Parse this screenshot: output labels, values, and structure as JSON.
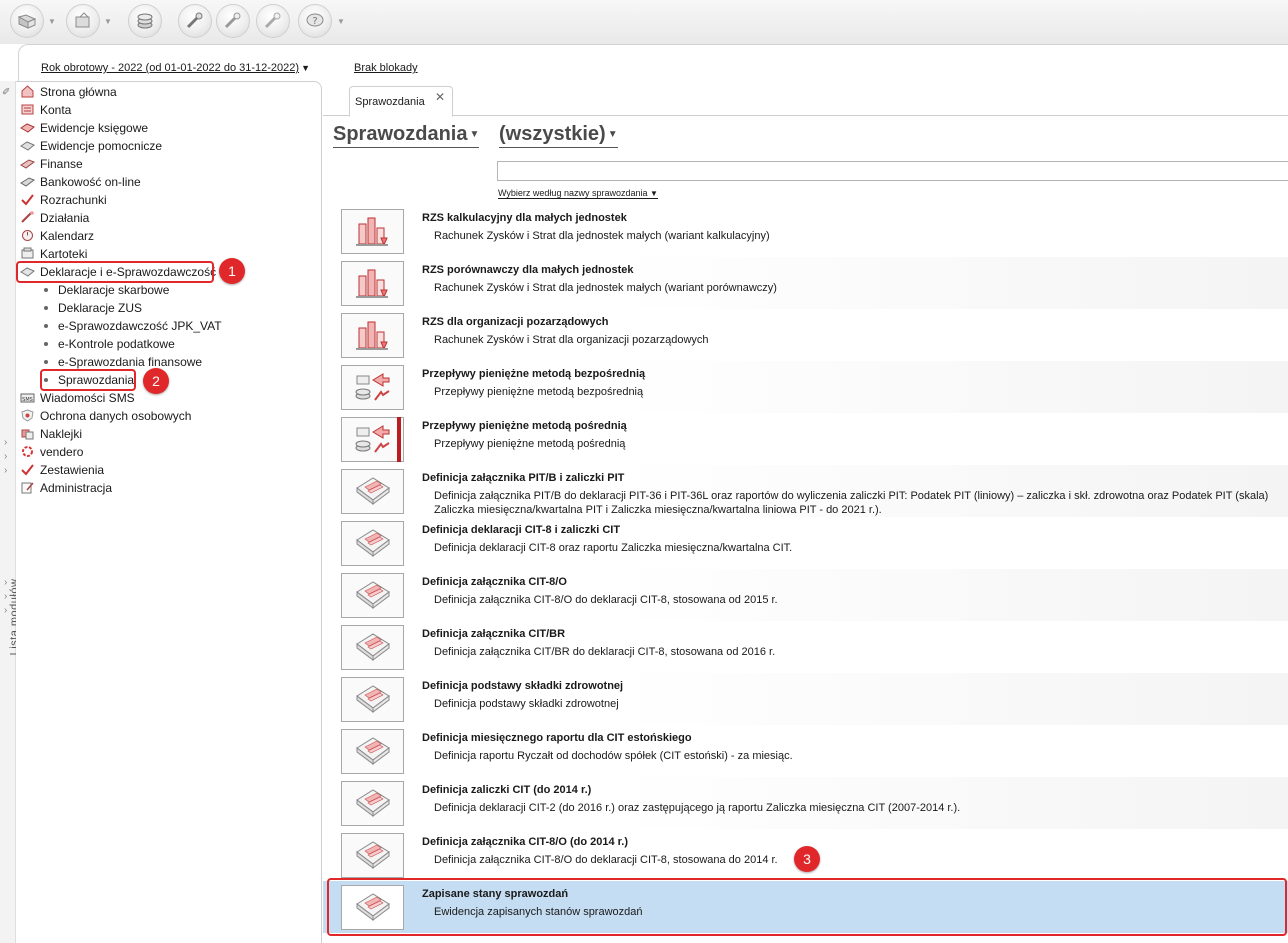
{
  "toolbar": {
    "buttons": [
      {
        "name": "open-icon"
      },
      {
        "name": "export-icon"
      },
      {
        "name": "coins-icon"
      },
      {
        "name": "tools-icon"
      },
      {
        "name": "tools-alt-icon"
      },
      {
        "name": "tools-gray-icon"
      },
      {
        "name": "help-icon"
      }
    ]
  },
  "header": {
    "fiscal_year": "Rok obrotowy - 2022  (od 01-01-2022 do 31-12-2022)",
    "lock_status": "Brak blokady"
  },
  "left_strip": {
    "label": "Lista modułów"
  },
  "sidebar": {
    "items": [
      {
        "label": "Strona główna",
        "icon": "home-icon"
      },
      {
        "label": "Konta",
        "icon": "accounts-icon"
      },
      {
        "label": "Ewidencje księgowe",
        "icon": "ledger-icon"
      },
      {
        "label": "Ewidencje pomocnicze",
        "icon": "aux-ledger-icon"
      },
      {
        "label": "Finanse",
        "icon": "finance-icon"
      },
      {
        "label": "Bankowość on-line",
        "icon": "bank-icon"
      },
      {
        "label": "Rozrachunki",
        "icon": "settlements-icon"
      },
      {
        "label": "Działania",
        "icon": "actions-icon"
      },
      {
        "label": "Kalendarz",
        "icon": "calendar-icon"
      },
      {
        "label": "Kartoteki",
        "icon": "card-index-icon"
      },
      {
        "label": "Deklaracje i e-Sprawozdawczość",
        "icon": "declarations-icon"
      }
    ],
    "sub_items": [
      {
        "label": "Deklaracje skarbowe"
      },
      {
        "label": "Deklaracje ZUS"
      },
      {
        "label": "e-Sprawozdawczość JPK_VAT"
      },
      {
        "label": "e-Kontrole podatkowe"
      },
      {
        "label": "e-Sprawozdania finansowe"
      },
      {
        "label": "Sprawozdania"
      }
    ],
    "items_after": [
      {
        "label": "Wiadomości SMS",
        "icon": "sms-icon"
      },
      {
        "label": "Ochrona danych osobowych",
        "icon": "shield-icon"
      },
      {
        "label": "Naklejki",
        "icon": "stickers-icon"
      },
      {
        "label": "vendero",
        "icon": "vendero-icon"
      },
      {
        "label": "Zestawienia",
        "icon": "summaries-icon"
      },
      {
        "label": "Administracja",
        "icon": "admin-icon"
      }
    ]
  },
  "annotations": {
    "badge_1": "1",
    "badge_2": "2",
    "badge_3": "3",
    "accent_color": "#e0282a"
  },
  "main": {
    "tab_label": "Sprawozdania",
    "tab_close": "✕",
    "view_title": "Sprawozdania",
    "filter_title": "(wszystkie)",
    "search_value": "",
    "search_hint": "Wybierz według nazwy sprawozdania",
    "selected_color": "#c4ddf2",
    "reports": [
      {
        "title": "RZS kalkulacyjny dla małych jednostek",
        "desc": "Rachunek Zysków i Strat dla jednostek małych (wariant kalkulacyjny)",
        "icon": "bar-chart-icon"
      },
      {
        "title": "RZS porównawczy dla małych jednostek",
        "desc": "Rachunek Zysków i Strat dla jednostek małych (wariant porównawczy)",
        "icon": "bar-chart-icon"
      },
      {
        "title": "RZS dla organizacji pozarządowych",
        "desc": "Rachunek Zysków i Strat dla organizacji pozarządowych",
        "icon": "bar-chart-icon"
      },
      {
        "title": "Przepływy pieniężne metodą bezpośrednią",
        "desc": "Przepływy pieniężne metodą bezpośrednią",
        "icon": "cash-flow-icon"
      },
      {
        "title": "Przepływy pieniężne metodą pośrednią",
        "desc": "Przepływy pieniężne metodą pośrednią",
        "icon": "cash-flow-icon"
      },
      {
        "title": "Definicja załącznika PIT/B i zaliczki PIT",
        "desc": "Definicja załącznika PIT/B do deklaracji PIT-36 i PIT-36L oraz raportów do wyliczenia zaliczki PIT: Podatek PIT (liniowy) – zaliczka i skł. zdrowotna oraz Podatek PIT (skala)\nZaliczka miesięczna/kwartalna PIT i Zaliczka miesięczna/kwartalna liniowa PIT - do 2021 r.).",
        "icon": "form-icon"
      },
      {
        "title": "Definicja deklaracji CIT-8 i zaliczki CIT",
        "desc": "Definicja deklaracji CIT-8 oraz raportu Zaliczka miesięczna/kwartalna CIT.",
        "icon": "form-icon"
      },
      {
        "title": "Definicja załącznika CIT-8/O",
        "desc": "Definicja załącznika CIT-8/O do deklaracji CIT-8, stosowana od 2015 r.",
        "icon": "form-icon"
      },
      {
        "title": "Definicja załącznika CIT/BR",
        "desc": "Definicja załącznika CIT/BR do deklaracji CIT-8, stosowana od 2016 r.",
        "icon": "form-icon"
      },
      {
        "title": "Definicja podstawy składki zdrowotnej",
        "desc": "Definicja podstawy składki zdrowotnej",
        "icon": "form-icon"
      },
      {
        "title": "Definicja miesięcznego raportu dla CIT estońskiego",
        "desc": "Definicja raportu Ryczałt od dochodów spółek (CIT estoński) - za miesiąc.",
        "icon": "form-icon"
      },
      {
        "title": "Definicja zaliczki CIT (do 2014 r.)",
        "desc": "Definicja deklaracji CIT-2 (do 2016 r.) oraz zastępującego ją raportu Zaliczka miesięczna CIT (2007-2014 r.).",
        "icon": "form-icon"
      },
      {
        "title": "Definicja załącznika CIT-8/O (do 2014 r.)",
        "desc": "Definicja załącznika CIT-8/O do deklaracji CIT-8, stosowana do 2014 r.",
        "icon": "form-icon"
      },
      {
        "title": "Zapisane stany sprawozdań",
        "desc": "Ewidencja zapisanych stanów sprawozdań",
        "icon": "form-icon"
      }
    ]
  }
}
